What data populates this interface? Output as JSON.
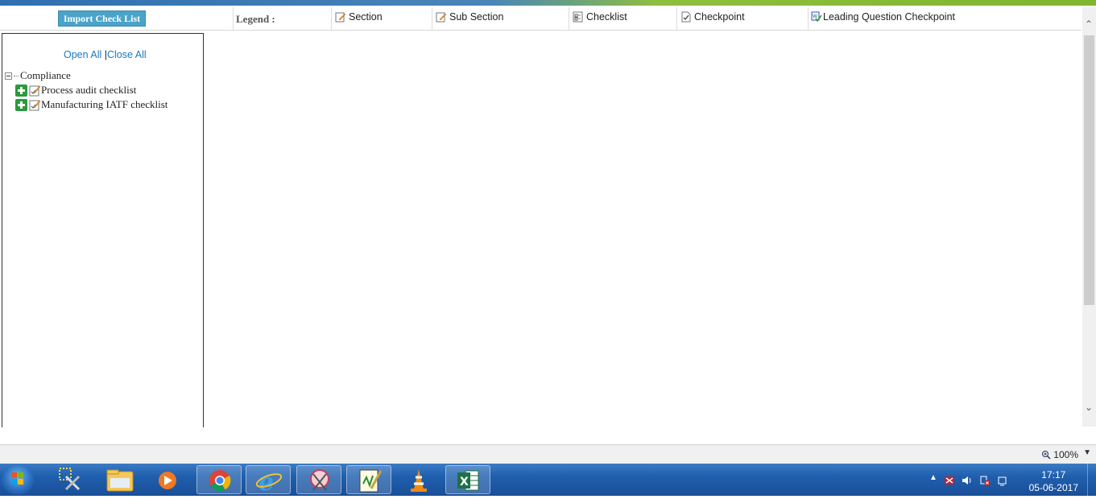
{
  "toolbar": {
    "import_label": "Import Check List"
  },
  "legend": {
    "label": "Legend :",
    "items": [
      {
        "label": "Section",
        "icon": "section-icon"
      },
      {
        "label": "Sub Section",
        "icon": "sub-section-icon"
      },
      {
        "label": "Checklist",
        "icon": "checklist-icon"
      },
      {
        "label": "Checkpoint",
        "icon": "checkpoint-icon"
      },
      {
        "label": "Leading Question Checkpoint",
        "icon": "leading-question-checkpoint-icon"
      }
    ]
  },
  "tree": {
    "open_all": "Open All",
    "separator": "|",
    "close_all": "Close All",
    "root": "Compliance",
    "children": [
      "Process audit checklist",
      "Manufacturing IATF checklist"
    ]
  },
  "statusbar": {
    "zoom": "100%"
  },
  "taskbar": {
    "time": "17:17",
    "date": "05-06-2017",
    "apps": [
      "snipping-tool-icon",
      "file-explorer-icon",
      "media-player-icon",
      "chrome-icon",
      "internet-explorer-icon",
      "scissors-app-icon",
      "notepad-icon",
      "vlc-icon",
      "excel-icon"
    ]
  },
  "colors": {
    "import_button": "#4aa3c9",
    "link": "#1a7ac0",
    "taskbar": "#1f5fae",
    "tree_expander": "#2a9a3a"
  }
}
